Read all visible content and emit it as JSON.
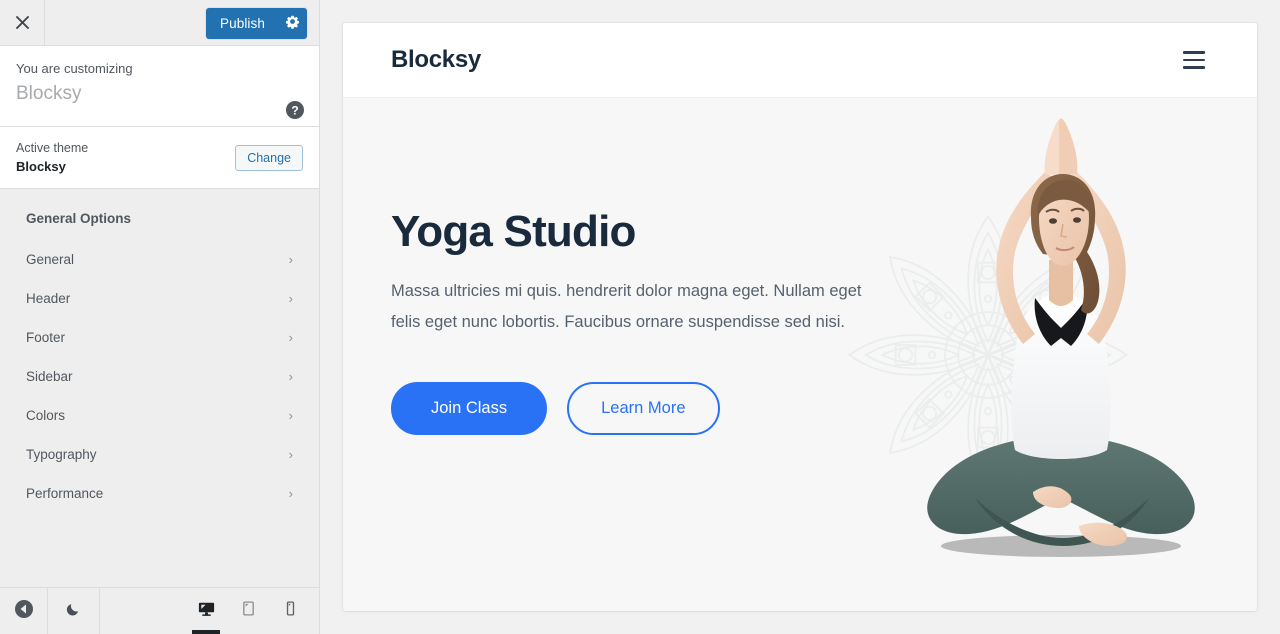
{
  "customizer": {
    "topbar": {
      "close_icon": "close-x-icon",
      "publish_label": "Publish",
      "gear_icon": "gear-icon"
    },
    "info": {
      "label": "You are customizing",
      "title": "Blocksy",
      "help_icon": "help-circle-icon"
    },
    "theme": {
      "label": "Active theme",
      "name": "Blocksy",
      "change_label": "Change"
    },
    "panel": {
      "section_title": "General Options",
      "items": [
        {
          "label": "General",
          "chevron": "›"
        },
        {
          "label": "Header",
          "chevron": "›"
        },
        {
          "label": "Footer",
          "chevron": "›"
        },
        {
          "label": "Sidebar",
          "chevron": "›"
        },
        {
          "label": "Colors",
          "chevron": "›"
        },
        {
          "label": "Typography",
          "chevron": "›"
        },
        {
          "label": "Performance",
          "chevron": "›"
        }
      ]
    },
    "bottombar": {
      "collapse_icon": "collapse-left-arrow-icon",
      "darkmode_icon": "moon-icon",
      "devices": [
        {
          "name": "desktop",
          "icon": "desktop-icon",
          "active": true
        },
        {
          "name": "tablet",
          "icon": "tablet-icon",
          "active": false
        },
        {
          "name": "mobile",
          "icon": "mobile-icon",
          "active": false
        }
      ]
    }
  },
  "preview": {
    "header": {
      "logo": "Blocksy",
      "menu_icon": "hamburger-menu-icon"
    },
    "hero": {
      "title": "Yoga Studio",
      "text": "Massa ultricies mi quis. hendrerit dolor magna eget. Nullam eget felis eget nunc lobortis. Faucibus ornare suspendisse sed nisi.",
      "primary_button": "Join Class",
      "secondary_button": "Learn More",
      "image_alt": "woman-in-lotus-yoga-pose-image",
      "background_pattern": "mandala-pattern"
    }
  },
  "colors": {
    "admin_blue": "#2271b1",
    "theme_accent": "#2a72f5",
    "heading_navy": "#192a3d",
    "sidebar_bg": "#eeeeee",
    "hero_bg": "#f7f7f8",
    "body_text": "#56616e"
  }
}
